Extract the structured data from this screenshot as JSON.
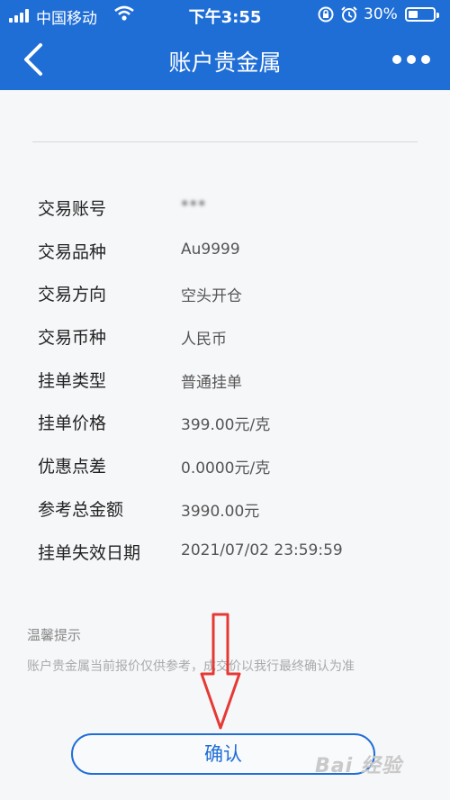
{
  "status_bar": {
    "carrier": "中国移动",
    "time": "下午3:55",
    "battery": "30%"
  },
  "nav": {
    "title": "账户贵金属",
    "back_icon": "chevron-left-icon",
    "more_icon": "more-dots-icon"
  },
  "details": [
    {
      "label": "交易账号",
      "value": "*** ",
      "masked": true
    },
    {
      "label": "交易品种",
      "value": "Au9999"
    },
    {
      "label": "交易方向",
      "value": "空头开仓"
    },
    {
      "label": "交易币种",
      "value": "人民币"
    },
    {
      "label": "挂单类型",
      "value": "普通挂单"
    },
    {
      "label": "挂单价格",
      "value": "399.00元/克"
    },
    {
      "label": "优惠点差",
      "value": "0.0000元/克"
    },
    {
      "label": "参考总金额",
      "value": "3990.00元"
    },
    {
      "label": "挂单失效日期",
      "value": "2021/07/02 23:59:59"
    }
  ],
  "tips": {
    "title": "温馨提示",
    "text": "账户贵金属当前报价仅供参考，成交价以我行最终确认为准"
  },
  "confirm_label": "确认",
  "watermark": "Bai 经验",
  "colors": {
    "brand_blue": "#1f6ed6",
    "annotation_red": "#e53935"
  }
}
